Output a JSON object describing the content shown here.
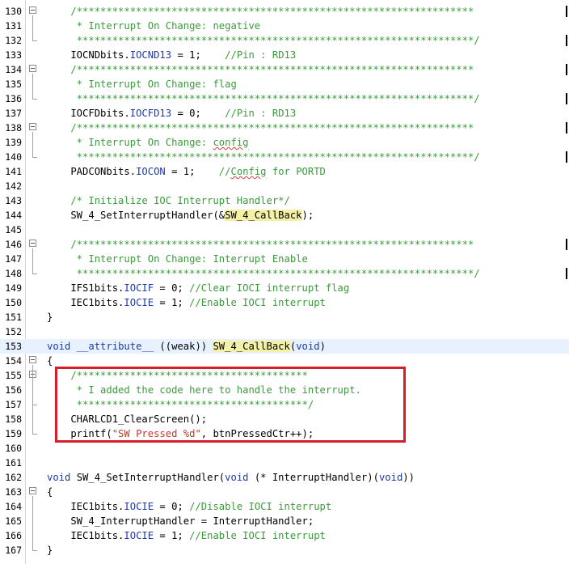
{
  "editor": {
    "lines": [
      {
        "n": "130",
        "fold": true,
        "code": [
          {
            "t": "    /*******************************************************************",
            "c": "cmt"
          }
        ]
      },
      {
        "n": "131",
        "code": [
          {
            "t": "     * Interrupt On Change: negative",
            "c": "cmt"
          }
        ]
      },
      {
        "n": "132",
        "code": [
          {
            "t": "     *******************************************************************/",
            "c": "cmt"
          }
        ]
      },
      {
        "n": "133",
        "code": [
          {
            "t": "    IOCNDbits."
          },
          {
            "t": "IOCND13",
            "c": "fld"
          },
          {
            "t": " = 1;    "
          },
          {
            "t": "//Pin : RD13",
            "c": "cmt"
          }
        ]
      },
      {
        "n": "134",
        "fold": true,
        "code": [
          {
            "t": "    /*******************************************************************",
            "c": "cmt"
          }
        ]
      },
      {
        "n": "135",
        "code": [
          {
            "t": "     * Interrupt On Change: flag",
            "c": "cmt"
          }
        ]
      },
      {
        "n": "136",
        "code": [
          {
            "t": "     *******************************************************************/",
            "c": "cmt"
          }
        ]
      },
      {
        "n": "137",
        "code": [
          {
            "t": "    IOCFDbits."
          },
          {
            "t": "IOCFD13",
            "c": "fld"
          },
          {
            "t": " = 0;    "
          },
          {
            "t": "//Pin : RD13",
            "c": "cmt"
          }
        ]
      },
      {
        "n": "138",
        "fold": true,
        "code": [
          {
            "t": "    /*******************************************************************",
            "c": "cmt"
          }
        ]
      },
      {
        "n": "139",
        "code": [
          {
            "t": "     * Interrupt On Change: ",
            "c": "cmt"
          },
          {
            "t": "config",
            "c": "cmt squig"
          }
        ]
      },
      {
        "n": "140",
        "code": [
          {
            "t": "     *******************************************************************/",
            "c": "cmt"
          }
        ]
      },
      {
        "n": "141",
        "code": [
          {
            "t": "    PADCONbits."
          },
          {
            "t": "IOCON",
            "c": "fld"
          },
          {
            "t": " = 1;    "
          },
          {
            "t": "//",
            "c": "cmt"
          },
          {
            "t": "Config",
            "c": "cmt squig"
          },
          {
            "t": " for PORTD",
            "c": "cmt"
          }
        ]
      },
      {
        "n": "142",
        "code": []
      },
      {
        "n": "143",
        "code": [
          {
            "t": "    /* Initialize IOC Interrupt Handler*/",
            "c": "cmt"
          }
        ]
      },
      {
        "n": "144",
        "code": [
          {
            "t": "    SW_4_SetInterruptHandler(&"
          },
          {
            "t": "SW_4_CallBack",
            "c": "mark"
          },
          {
            "t": ");"
          }
        ]
      },
      {
        "n": "145",
        "code": []
      },
      {
        "n": "146",
        "fold": true,
        "code": [
          {
            "t": "    /*******************************************************************",
            "c": "cmt"
          }
        ]
      },
      {
        "n": "147",
        "code": [
          {
            "t": "     * Interrupt On Change: Interrupt Enable",
            "c": "cmt"
          }
        ]
      },
      {
        "n": "148",
        "code": [
          {
            "t": "     *******************************************************************/",
            "c": "cmt"
          }
        ]
      },
      {
        "n": "149",
        "code": [
          {
            "t": "    IFS1bits."
          },
          {
            "t": "IOCIF",
            "c": "fld"
          },
          {
            "t": " = 0; "
          },
          {
            "t": "//Clear IOCI interrupt flag",
            "c": "cmt"
          }
        ]
      },
      {
        "n": "150",
        "code": [
          {
            "t": "    IEC1bits."
          },
          {
            "t": "IOCIE",
            "c": "fld"
          },
          {
            "t": " = 1; "
          },
          {
            "t": "//Enable IOCI interrupt",
            "c": "cmt"
          }
        ]
      },
      {
        "n": "151",
        "code": [
          {
            "t": "}"
          }
        ]
      },
      {
        "n": "152",
        "code": []
      },
      {
        "n": "153",
        "hl": true,
        "code": [
          {
            "t": "void",
            "c": "kw"
          },
          {
            "t": " "
          },
          {
            "t": "__attribute__",
            "c": "kw"
          },
          {
            "t": " ((weak)) "
          },
          {
            "t": "SW_4_CallBack",
            "c": "mark"
          },
          {
            "t": "("
          },
          {
            "t": "void",
            "c": "kw"
          },
          {
            "t": ")"
          }
        ]
      },
      {
        "n": "154",
        "fold": true,
        "code": [
          {
            "t": "{"
          }
        ]
      },
      {
        "n": "155",
        "fold": true,
        "code": [
          {
            "t": "    /***************************************",
            "c": "cmt"
          }
        ]
      },
      {
        "n": "156",
        "code": [
          {
            "t": "     * I added the code here to handle the interrupt.",
            "c": "cmt"
          }
        ]
      },
      {
        "n": "157",
        "code": [
          {
            "t": "     ***************************************/",
            "c": "cmt"
          }
        ]
      },
      {
        "n": "158",
        "code": [
          {
            "t": "    CHARLCD1_ClearScreen();"
          }
        ]
      },
      {
        "n": "159",
        "code": [
          {
            "t": "    printf("
          },
          {
            "t": "\"SW Pressed %d\"",
            "c": "str"
          },
          {
            "t": ", btnPressedCtr++);"
          }
        ]
      },
      {
        "n": "160",
        "code": []
      },
      {
        "n": "161",
        "code": []
      },
      {
        "n": "162",
        "code": [
          {
            "t": "void",
            "c": "kw"
          },
          {
            "t": " SW_4_SetInterruptHandler("
          },
          {
            "t": "void",
            "c": "kw"
          },
          {
            "t": " (* InterruptHandler)("
          },
          {
            "t": "void",
            "c": "kw"
          },
          {
            "t": "))"
          }
        ]
      },
      {
        "n": "163",
        "fold": true,
        "code": [
          {
            "t": "{"
          }
        ]
      },
      {
        "n": "164",
        "code": [
          {
            "t": "    IEC1bits."
          },
          {
            "t": "IOCIE",
            "c": "fld"
          },
          {
            "t": " = 0; "
          },
          {
            "t": "//Disable IOCI interrupt",
            "c": "cmt"
          }
        ]
      },
      {
        "n": "165",
        "code": [
          {
            "t": "    SW_4_InterruptHandler = InterruptHandler;"
          }
        ]
      },
      {
        "n": "166",
        "code": [
          {
            "t": "    IEC1bits."
          },
          {
            "t": "IOCIE",
            "c": "fld"
          },
          {
            "t": " = 1; "
          },
          {
            "t": "//Enable IOCI interrupt",
            "c": "cmt"
          }
        ]
      },
      {
        "n": "167",
        "code": [
          {
            "t": "}"
          }
        ]
      }
    ],
    "colors": {
      "comment": "#3c9a3c",
      "keyword": "#1f3aa8",
      "string": "#c0392b",
      "highlight": "#f4f1a6",
      "current_line": "#e8f2fe",
      "annotation_box": "#d41f2a"
    }
  }
}
